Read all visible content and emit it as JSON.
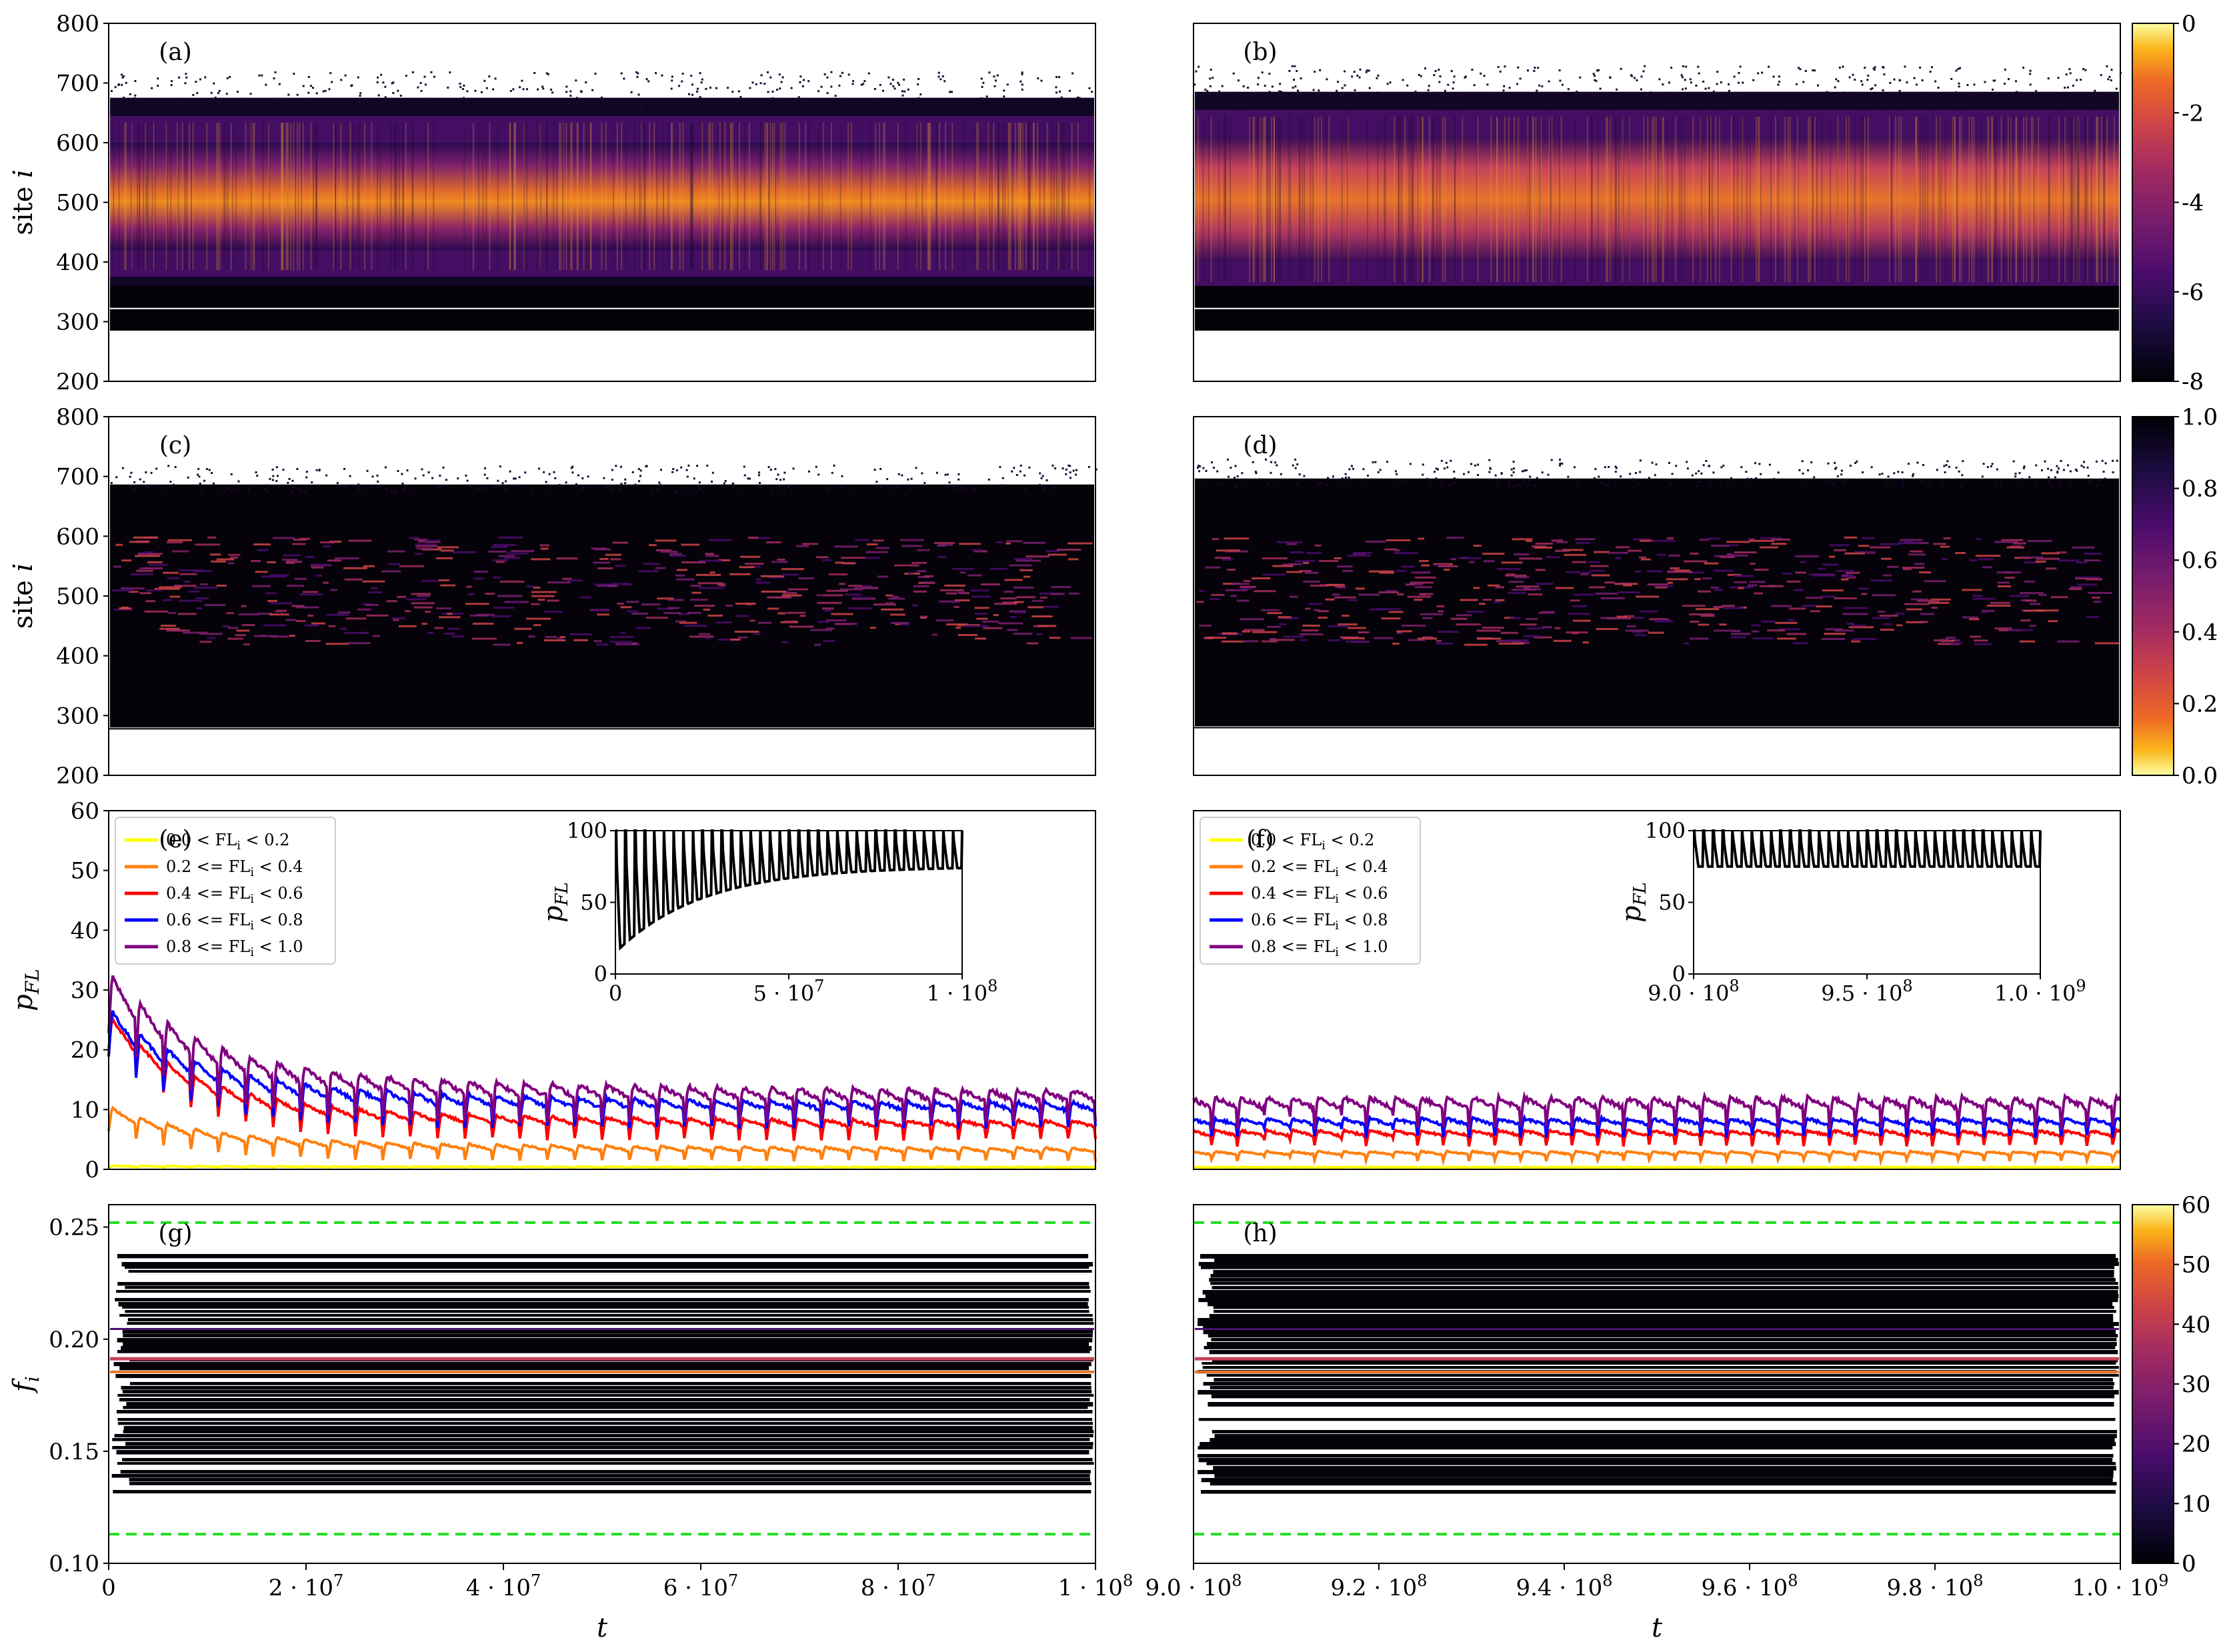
{
  "chart_data": [
    {
      "panel": "(a)",
      "type": "heatmap",
      "ylabel": "site i",
      "yticks": [
        "800",
        "700",
        "600",
        "500",
        "400",
        "300",
        "200"
      ],
      "ylim": [
        200,
        800
      ],
      "xlim": [
        0,
        100000000
      ],
      "colorbar": {
        "ticks": [
          "0",
          "-2",
          "-4",
          "-6",
          "-8"
        ],
        "range": [
          -8,
          0
        ],
        "colormap": "inferno"
      },
      "band": {
        "top_site": 720,
        "bottom_site": 285,
        "core_top": 600,
        "core_bottom": 420
      }
    },
    {
      "panel": "(b)",
      "type": "heatmap",
      "yticks": [],
      "ylim": [
        200,
        800
      ],
      "xlim": [
        900000000,
        1000000000
      ],
      "colorbar": {
        "ticks": [
          "0",
          "-2",
          "-4",
          "-6",
          "-8"
        ],
        "range": [
          -8,
          0
        ],
        "colormap": "inferno"
      },
      "band": {
        "top_site": 730,
        "bottom_site": 285,
        "core_top": 610,
        "core_bottom": 400
      }
    },
    {
      "panel": "(c)",
      "type": "heatmap",
      "ylabel": "site i",
      "yticks": [
        "800",
        "700",
        "600",
        "500",
        "400",
        "300",
        "200"
      ],
      "ylim": [
        200,
        800
      ],
      "xlim": [
        0,
        100000000
      ],
      "colorbar": {
        "ticks": [
          "1.0",
          "0.8",
          "0.6",
          "0.4",
          "0.2",
          "0.0"
        ],
        "range": [
          0,
          1
        ],
        "colormap": "inferno_r"
      },
      "band": {
        "top_site": 720,
        "bottom_site": 280
      }
    },
    {
      "panel": "(d)",
      "type": "heatmap",
      "yticks": [],
      "ylim": [
        200,
        800
      ],
      "xlim": [
        900000000,
        1000000000
      ],
      "colorbar": {
        "ticks": [
          "1.0",
          "0.8",
          "0.6",
          "0.4",
          "0.2",
          "0.0"
        ],
        "range": [
          0,
          1
        ],
        "colormap": "inferno_r"
      },
      "band": {
        "top_site": 730,
        "bottom_site": 282
      }
    },
    {
      "panel": "(e)",
      "type": "line",
      "ylabel": "p",
      "ylabel_sub": "FL",
      "yticks": [
        "60",
        "50",
        "40",
        "30",
        "20",
        "10",
        "0"
      ],
      "ylim": [
        0,
        60
      ],
      "xlim": [
        0,
        100000000
      ],
      "legend": [
        "0.0 < FL",
        "0.2 <= FL",
        "0.4 <= FL",
        "0.6 <= FL",
        "0.8 <= FL"
      ],
      "legend_tail": [
        "< 0.2",
        "< 0.4",
        "< 0.6",
        "< 0.8",
        "< 1.0"
      ],
      "legend_sub": "i",
      "legend_colors": [
        "#ffff00",
        "#ff7f0e",
        "#ff0000",
        "#0000ff",
        "#800080"
      ],
      "series": [
        {
          "name": "0.0 < FL_i < 0.2",
          "values": [
            0,
            0,
            0,
            0,
            0
          ],
          "base": 0.2,
          "amp": 0.2
        },
        {
          "name": "0.2 <= FL_i < 0.4",
          "values": [
            10,
            4,
            3,
            2,
            2
          ],
          "base": 1.5,
          "amp": 2
        },
        {
          "name": "0.4 <= FL_i < 0.6",
          "values": [
            30,
            12,
            10,
            7,
            6
          ],
          "base": 5,
          "amp": 3
        },
        {
          "name": "0.6 <= FL_i < 0.8",
          "values": [
            24,
            15,
            11,
            9,
            8
          ],
          "base": 7,
          "amp": 4
        },
        {
          "name": "0.8 <= FL_i < 1.0",
          "values": [
            30,
            20,
            15,
            12,
            10
          ],
          "base": 8,
          "amp": 5
        }
      ],
      "inset": {
        "ylabel": "p",
        "ylabel_sub": "FL",
        "yticks": [
          "100",
          "50",
          "0"
        ],
        "xticks": [
          "0",
          "5 · 10",
          "1 · 10"
        ],
        "xticks_exp": [
          "",
          "7",
          "8"
        ],
        "ylim": [
          0,
          100
        ]
      }
    },
    {
      "panel": "(f)",
      "type": "line",
      "yticks": [],
      "ylim": [
        0,
        60
      ],
      "xlim": [
        900000000,
        1000000000
      ],
      "legend": [
        "0.0 < FL",
        "0.2 <= FL",
        "0.4 <= FL",
        "0.6 <= FL",
        "0.8 <= FL"
      ],
      "legend_tail": [
        "< 0.2",
        "< 0.4",
        "< 0.6",
        "< 0.8",
        "< 1.0"
      ],
      "legend_sub": "i",
      "legend_colors": [
        "#ffff00",
        "#ff7f0e",
        "#ff0000",
        "#0000ff",
        "#800080"
      ],
      "series": [
        {
          "name": "0.0 < FL_i < 0.2",
          "base": 0.2,
          "amp": 0.2
        },
        {
          "name": "0.2 <= FL_i < 0.4",
          "base": 1.5,
          "amp": 1.5
        },
        {
          "name": "0.4 <= FL_i < 0.6",
          "base": 4,
          "amp": 2.5
        },
        {
          "name": "0.6 <= FL_i < 0.8",
          "base": 5.5,
          "amp": 3
        },
        {
          "name": "0.8 <= FL_i < 1.0",
          "base": 7,
          "amp": 5
        }
      ],
      "inset": {
        "ylabel": "p",
        "ylabel_sub": "FL",
        "yticks": [
          "100",
          "50",
          "0"
        ],
        "xticks": [
          "9.0 · 10",
          "9.5 · 10",
          "1.0 · 10"
        ],
        "xticks_exp": [
          "8",
          "8",
          "9"
        ],
        "ylim": [
          0,
          100
        ]
      }
    },
    {
      "panel": "(g)",
      "type": "heatmap",
      "ylabel": "f",
      "ylabel_sub": "i",
      "yticks": [
        "0.25",
        "0.20",
        "0.15",
        "0.10"
      ],
      "ylim": [
        0.1,
        0.26
      ],
      "xlabel": "t",
      "xticks": [
        "0",
        "2 · 10",
        "4 · 10",
        "6 · 10",
        "8 · 10",
        "1 · 10"
      ],
      "xticks_exp": [
        "",
        "7",
        "7",
        "7",
        "7",
        "8"
      ],
      "xlim": [
        0,
        100000000
      ],
      "hlines": [
        0.252,
        0.113
      ],
      "hline_color": "#22dd22",
      "colorbar": {
        "ticks": [
          "60",
          "50",
          "40",
          "30",
          "20",
          "10",
          "0"
        ],
        "range": [
          0,
          60
        ],
        "colormap": "inferno"
      }
    },
    {
      "panel": "(h)",
      "type": "heatmap",
      "xlabel": "t",
      "xticks": [
        "9.0 · 10",
        "9.2 · 10",
        "9.4 · 10",
        "9.6 · 10",
        "9.8 · 10",
        "1.0 · 10"
      ],
      "xticks_exp": [
        "8",
        "8",
        "8",
        "8",
        "8",
        "9"
      ],
      "xlim": [
        900000000,
        1000000000
      ],
      "ylim": [
        0.1,
        0.26
      ],
      "hlines": [
        0.252,
        0.113
      ],
      "hline_color": "#22dd22",
      "colorbar": {
        "ticks": [
          "60",
          "50",
          "40",
          "30",
          "20",
          "10",
          "0"
        ],
        "range": [
          0,
          60
        ],
        "colormap": "inferno"
      }
    }
  ]
}
